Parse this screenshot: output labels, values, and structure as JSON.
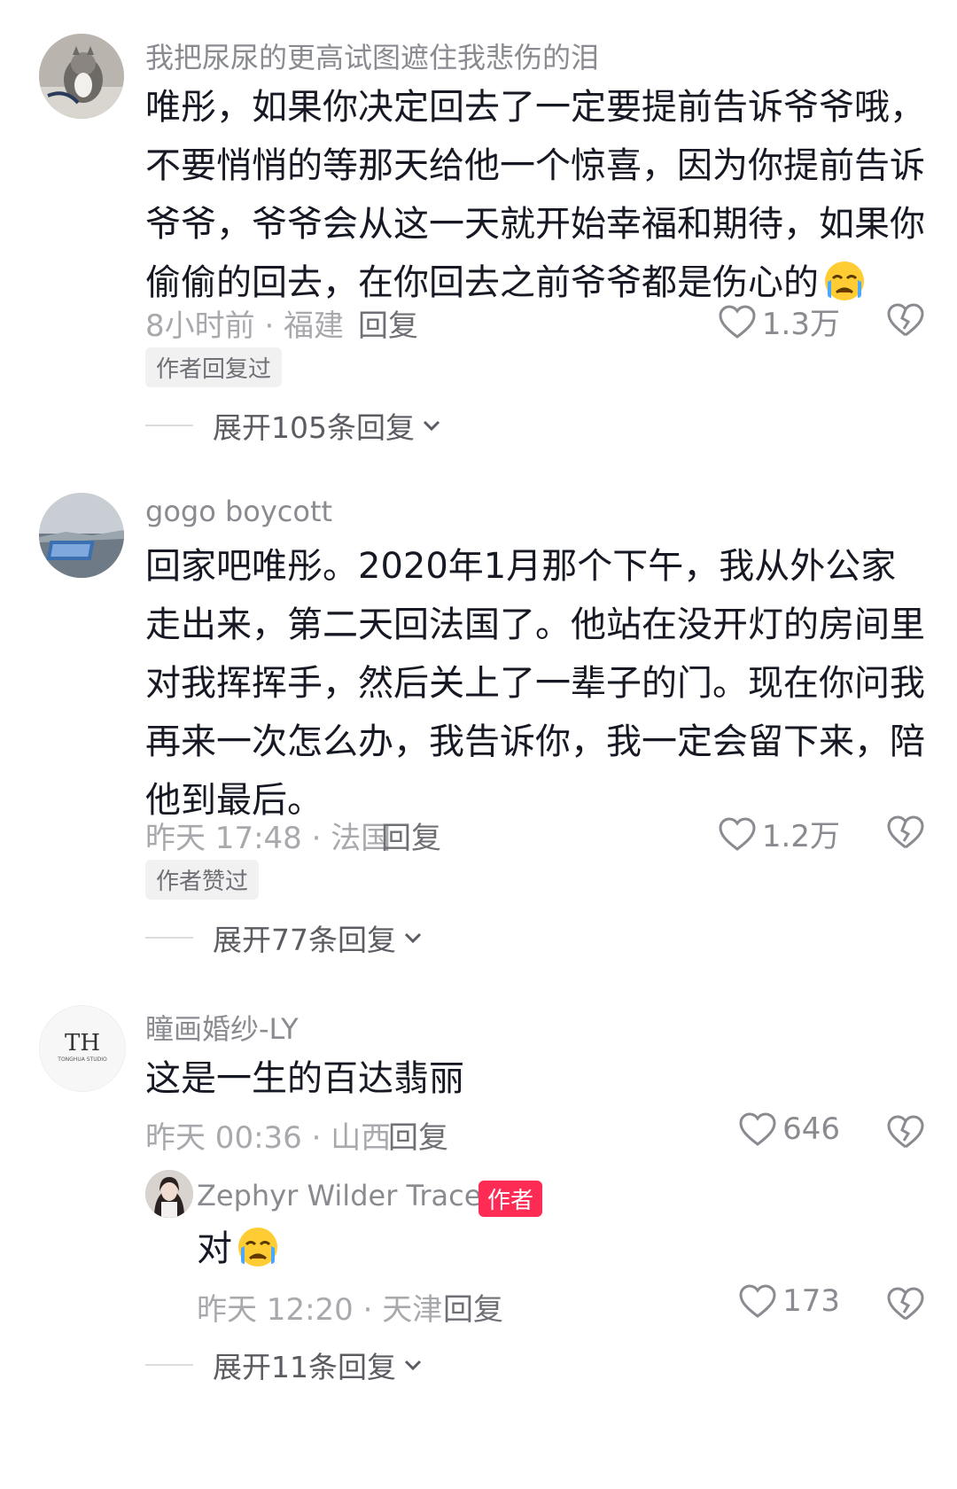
{
  "comments": [
    {
      "username": "我把尿尿的更高试图遮住我悲伤的泪",
      "text": "唯彤，如果你决定回去了一定要提前告诉爷爷哦，不要悄悄的等那天给他一个惊喜，因为你提前告诉爷爷，爷爷会从这一天就开始幸福和期待，如果你偷偷的回去，在你回去之前爷爷都是伤心的",
      "meta": "8小时前 · 福建",
      "reply_label": "回复",
      "likes": "1.3万",
      "badge": "作者回复过",
      "expand_label": "展开105条回复"
    },
    {
      "username": "gogo boycott",
      "text": "回家吧唯彤。2020年1月那个下午，我从外公家走出来，第二天回法国了。他站在没开灯的房间里对我挥挥手，然后关上了一辈子的门。现在你问我再来一次怎么办，我告诉你，我一定会留下来，陪他到最后。",
      "meta": "昨天 17:48 · 法国",
      "reply_label": "回复",
      "likes": "1.2万",
      "badge": "作者赞过",
      "expand_label": "展开77条回复"
    },
    {
      "username": "瞳画婚纱-LY",
      "text": "这是一生的百达翡丽",
      "meta": "昨天 00:36 · 山西",
      "reply_label": "回复",
      "likes": "646",
      "avatar_logo": "TH",
      "avatar_logo_sub": "TONGHUA STUDIO",
      "reply": {
        "username": "Zephyr Wilder Trace",
        "author_tag": "作者",
        "text": "对",
        "meta": "昨天 12:20 · 天津",
        "reply_label": "回复",
        "likes": "173"
      },
      "expand_label": "展开11条回复"
    }
  ]
}
